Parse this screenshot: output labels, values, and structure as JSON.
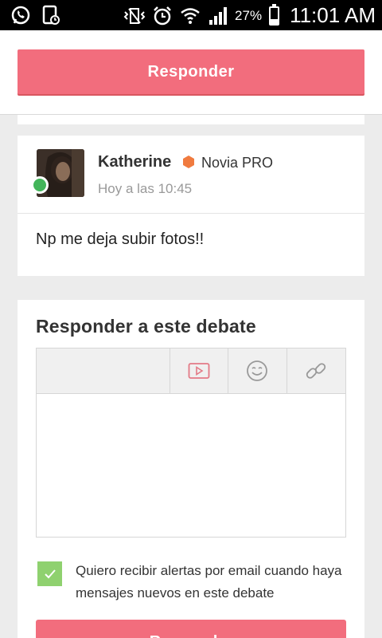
{
  "status_bar": {
    "battery_percent": "27%",
    "battery_level": 0.27,
    "time": "11:01 AM",
    "icons": [
      "whatsapp-icon",
      "screenshot-icon",
      "vibrate-icon",
      "alarm-icon",
      "wifi-icon",
      "signal-icon",
      "battery-icon"
    ]
  },
  "top_action": {
    "label": "Responder"
  },
  "post": {
    "author": "Katherine",
    "badge": "Novia PRO",
    "time": "Hoy a las 10:45",
    "body": "Np me deja subir fotos!!",
    "online": true
  },
  "reply_form": {
    "title": "Responder a este debate",
    "toolbar": [
      "video-icon",
      "emoji-icon",
      "link-icon"
    ],
    "textarea_value": "",
    "checkbox_checked": true,
    "checkbox_label": "Quiero recibir alertas por email cuando haya mensajes nuevos en este debate",
    "submit_label": "Responder"
  },
  "colors": {
    "accent": "#f26d7d",
    "online": "#43b55a",
    "badge": "#f07b3f",
    "checkbox": "#8fd16f"
  }
}
